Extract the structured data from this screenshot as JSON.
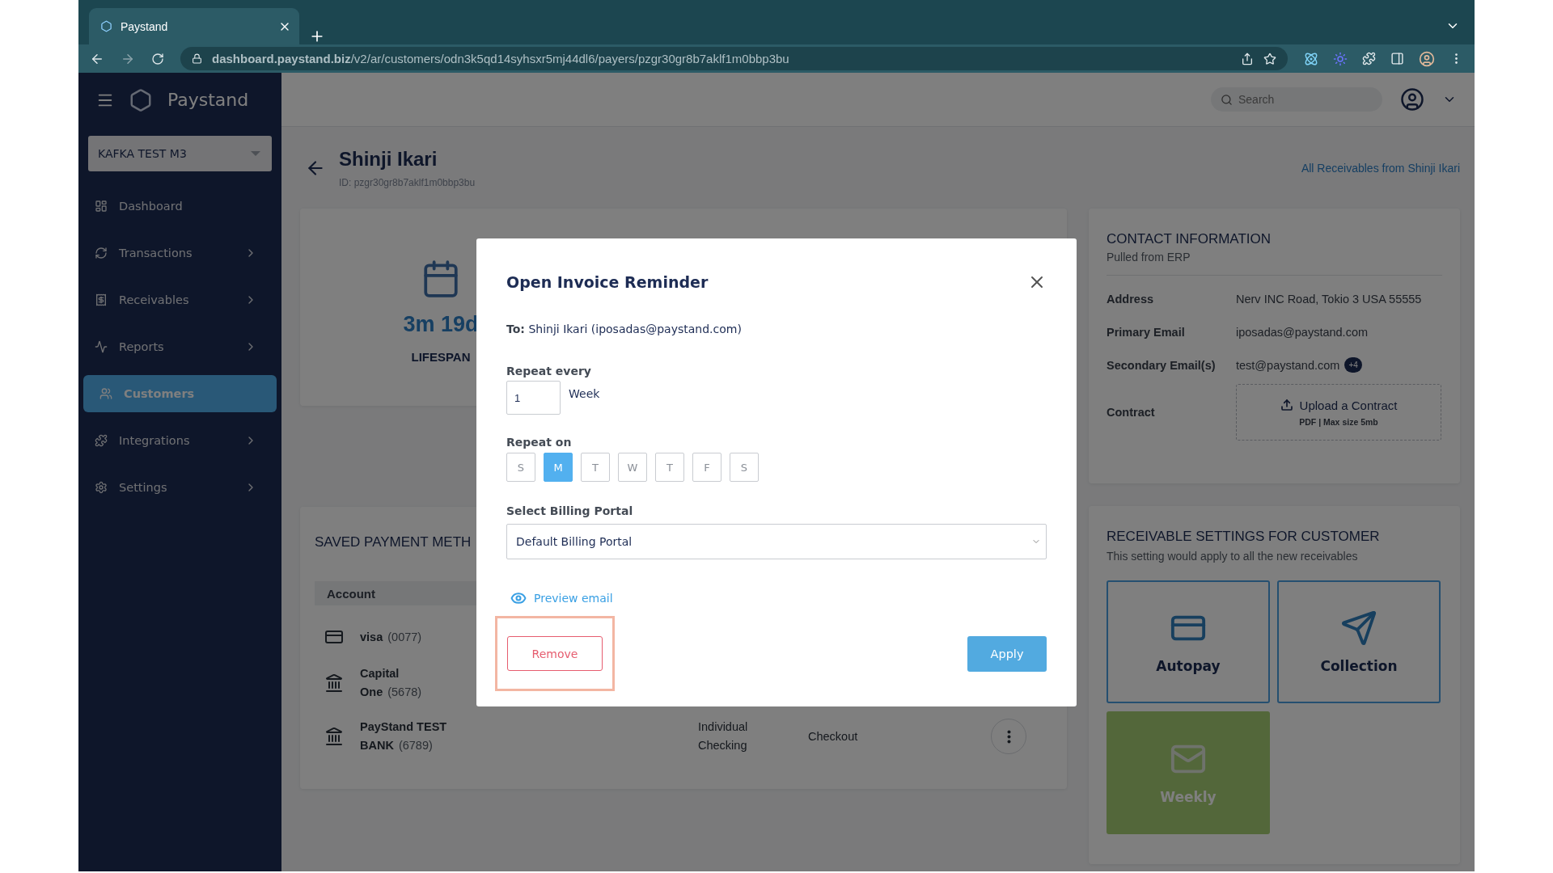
{
  "browser": {
    "tab_title": "Paystand",
    "url": "**dashboard.paystand.biz**/v2/ar/customers/odn3k5qd14syhsxr5mj44dl6/payers/pzgr30gr8b7aklf1m0bbp3bu"
  },
  "sidebar": {
    "brand": "Paystand",
    "organization": "KAFKA TEST M3",
    "items": [
      {
        "label": "Dashboard",
        "selected": false,
        "expandable": false
      },
      {
        "label": "Transactions",
        "selected": false,
        "expandable": true
      },
      {
        "label": "Receivables",
        "selected": false,
        "expandable": true
      },
      {
        "label": "Reports",
        "selected": false,
        "expandable": true
      },
      {
        "label": "Customers",
        "selected": true,
        "expandable": false
      },
      {
        "label": "Integrations",
        "selected": false,
        "expandable": true
      },
      {
        "label": "Settings",
        "selected": false,
        "expandable": true
      }
    ]
  },
  "top_bar": {
    "search": {
      "placeholder": "Search"
    }
  },
  "customer": {
    "name": "Shinji Ikari",
    "id": "ID: pzgr30gr8b7aklf1m0bbp3bu",
    "all_receivables_link": "All Receivables from Shinji Ikari"
  },
  "lifespan": {
    "value": "3m 19d",
    "label": "LIFESPAN"
  },
  "saved_payment_methods": {
    "title": "SAVED PAYMENT METH",
    "columns": [
      "Account"
    ],
    "rows": [
      {
        "kind": "card",
        "account": "visa",
        "last4": "(0077)"
      },
      {
        "kind": "bank",
        "account": "Capital One",
        "last4": "(5678)"
      },
      {
        "kind": "bank",
        "account": "PayStand TEST BANK",
        "last4": "(6789)",
        "type": "Individual Checking",
        "source": "Checkout",
        "menu": true
      }
    ]
  },
  "contact": {
    "title": "CONTACT INFORMATION",
    "subtitle": "Pulled from ERP",
    "fields": [
      {
        "label": "Address",
        "value": "Nerv INC Road, Tokio 3 USA 55555"
      },
      {
        "label": "Primary Email",
        "value": "iposadas@paystand.com"
      },
      {
        "label": "Secondary Email(s)",
        "value": "test@paystand.com",
        "badge": "+4"
      }
    ],
    "contract": {
      "label": "Contract",
      "upload": "Upload a Contract",
      "hint": "PDF | Max size 5mb"
    }
  },
  "receivable_settings": {
    "title": "RECEIVABLE SETTINGS FOR CUSTOMER",
    "subtitle": "This setting would apply to all the new receivables",
    "tiles": [
      {
        "label": "Autopay",
        "selected": false
      },
      {
        "label": "Collection",
        "selected": false
      },
      {
        "label": "Weekly",
        "selected": true
      }
    ]
  },
  "modal": {
    "title": "Open Invoice Reminder",
    "to_label": "To:",
    "to_value": "Shinji Ikari (iposadas@paystand.com)",
    "repeat_every_label": "Repeat every",
    "repeat_every_value": "1",
    "repeat_unit": "Week",
    "repeat_on_label": "Repeat on",
    "days": [
      {
        "label": "S",
        "selected": false
      },
      {
        "label": "M",
        "selected": true
      },
      {
        "label": "T",
        "selected": false
      },
      {
        "label": "W",
        "selected": false
      },
      {
        "label": "T",
        "selected": false
      },
      {
        "label": "F",
        "selected": false
      },
      {
        "label": "S",
        "selected": false
      }
    ],
    "portal_label": "Select Billing Portal",
    "portal_value": "Default Billing Portal",
    "preview_link": "Preview email",
    "remove_button": "Remove",
    "remove_highlighted": true,
    "apply_button": "Apply"
  }
}
